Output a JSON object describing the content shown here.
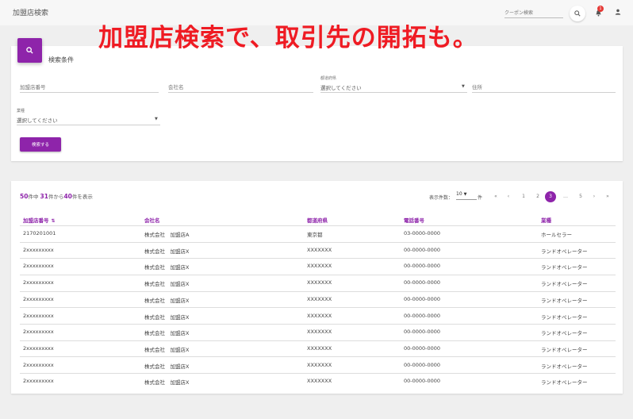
{
  "header": {
    "app_title": "加盟店検索",
    "coupon_search_placeholder": "クーポン検索",
    "notification_count": "1"
  },
  "headline": "加盟店検索で、取引先の開拓も。",
  "search_panel": {
    "title": "検索条件",
    "store_no_placeholder": "加盟店番号",
    "company_placeholder": "会社名",
    "prefecture_label": "都道府県",
    "prefecture_value": "選択してください",
    "address_placeholder": "住所",
    "industry_label": "業種",
    "industry_value": "選択してください",
    "submit_label": "検索する"
  },
  "results": {
    "total": "50",
    "total_suffix": "件中",
    "from": "31",
    "from_suffix": "件から",
    "to": "40",
    "to_suffix": "件を表示",
    "per_page_label": "表示件数：",
    "per_page_value": "10",
    "per_page_unit": "件",
    "pagination": [
      "«",
      "‹",
      "1",
      "2",
      "3",
      "…",
      "5",
      "›",
      "»"
    ],
    "active_page": "3",
    "columns": [
      "加盟店番号",
      "会社名",
      "都道府県",
      "電話番号",
      "業種"
    ],
    "rows": [
      [
        "2170201001",
        "株式会社　加盟店A",
        "東京都",
        "03-0000-0000",
        "ホールセラー"
      ],
      [
        "2xxxxxxxxx",
        "株式会社　加盟店X",
        "XXXXXXX",
        "00-0000-0000",
        "ランドオペレーター"
      ],
      [
        "2xxxxxxxxx",
        "株式会社　加盟店X",
        "XXXXXXX",
        "00-0000-0000",
        "ランドオペレーター"
      ],
      [
        "2xxxxxxxxx",
        "株式会社　加盟店X",
        "XXXXXXX",
        "00-0000-0000",
        "ランドオペレーター"
      ],
      [
        "2xxxxxxxxx",
        "株式会社　加盟店X",
        "XXXXXXX",
        "00-0000-0000",
        "ランドオペレーター"
      ],
      [
        "2xxxxxxxxx",
        "株式会社　加盟店X",
        "XXXXXXX",
        "00-0000-0000",
        "ランドオペレーター"
      ],
      [
        "2xxxxxxxxx",
        "株式会社　加盟店X",
        "XXXXXXX",
        "00-0000-0000",
        "ランドオペレーター"
      ],
      [
        "2xxxxxxxxx",
        "株式会社　加盟店X",
        "XXXXXXX",
        "00-0000-0000",
        "ランドオペレーター"
      ],
      [
        "2xxxxxxxxx",
        "株式会社　加盟店X",
        "XXXXXXX",
        "00-0000-0000",
        "ランドオペレーター"
      ],
      [
        "2xxxxxxxxx",
        "株式会社　加盟店X",
        "XXXXXXX",
        "00-0000-0000",
        "ランドオペレーター"
      ]
    ]
  },
  "colors": {
    "accent": "#8e24aa",
    "headline": "#ef1b23",
    "badge": "#e53935"
  },
  "icons": [
    "search-icon",
    "bell-icon",
    "user-icon",
    "sort-icon",
    "chevron-down-icon"
  ]
}
